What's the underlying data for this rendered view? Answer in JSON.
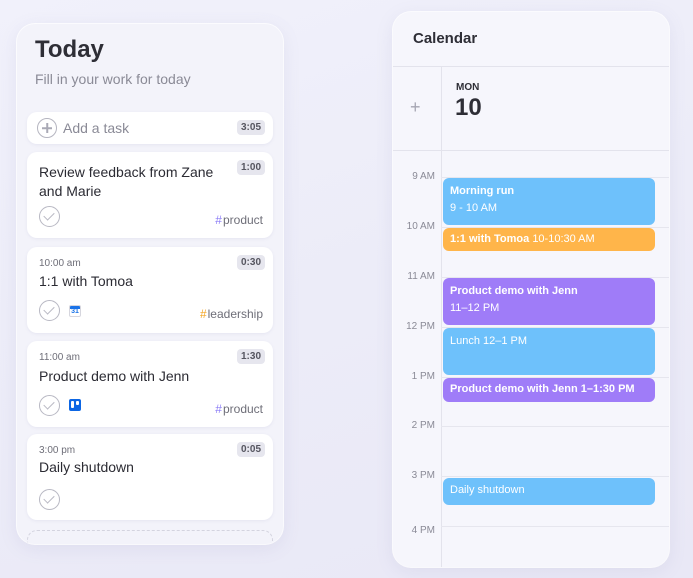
{
  "today": {
    "title": "Today",
    "subtitle": "Fill in your work for today",
    "add_task": {
      "label": "Add a task",
      "total": "3:05"
    },
    "tasks": [
      {
        "time": "",
        "title": "Review feedback from Zane and Marie",
        "duration": "1:00",
        "tag": "product",
        "tag_color": "#8b7cf6",
        "app": ""
      },
      {
        "time": "10:00 am",
        "title": "1:1 with Tomoa",
        "duration": "0:30",
        "tag": "leadership",
        "tag_color": "#f5a623",
        "app": "google-calendar-icon"
      },
      {
        "time": "11:00 am",
        "title": "Product demo with Jenn",
        "duration": "1:30",
        "tag": "product",
        "tag_color": "#8b7cf6",
        "app": "trello-icon"
      },
      {
        "time": "3:00 pm",
        "title": "Daily shutdown",
        "duration": "0:05",
        "tag": "",
        "tag_color": "",
        "app": ""
      }
    ],
    "tag_hash": "#",
    "gcal_day": "31"
  },
  "calendar": {
    "title": "Calendar",
    "add_symbol": "+",
    "day_name": "MON",
    "day_number": "10",
    "hours": [
      "9 AM",
      "10 AM",
      "11 AM",
      "12 PM",
      "1 PM",
      "2 PM",
      "3 PM",
      "4 PM"
    ],
    "events": [
      {
        "title": "Morning run",
        "subtitle": "9 - 10 AM",
        "color": "#6ec1fb"
      },
      {
        "title": "1:1 with Tomoa",
        "subtitle": "10-10:30 AM",
        "color": "#ffb54a"
      },
      {
        "title": "Product demo with Jenn",
        "subtitle": "11–12 PM",
        "color": "#9f7cf8"
      },
      {
        "title": "Lunch 12–1 PM",
        "subtitle": "",
        "color": "#6ec1fb"
      },
      {
        "title": "Product demo with Jenn 1–1:30 PM",
        "subtitle": "",
        "color": "#9f7cf8"
      },
      {
        "title": "Daily shutdown",
        "subtitle": "",
        "color": "#6ec1fb"
      }
    ]
  }
}
